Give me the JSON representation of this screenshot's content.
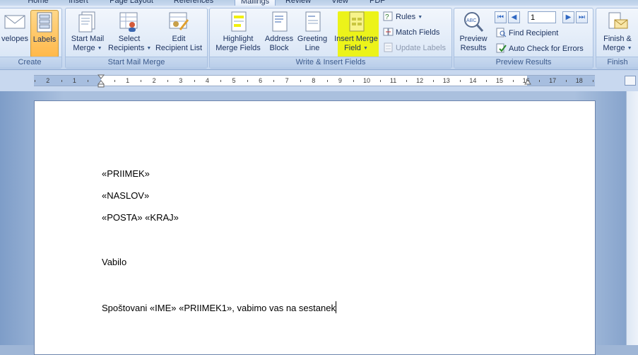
{
  "tabs": [
    {
      "label": "Home",
      "active": false
    },
    {
      "label": "Insert",
      "active": false
    },
    {
      "label": "Page Layout",
      "active": false
    },
    {
      "label": "References",
      "active": false
    },
    {
      "label": "Mailings",
      "active": true
    },
    {
      "label": "Review",
      "active": false
    },
    {
      "label": "View",
      "active": false
    },
    {
      "label": "PDF",
      "active": false
    }
  ],
  "ribbon": {
    "create": {
      "label": "Create",
      "envelopes": "velopes",
      "labels": "Labels"
    },
    "start_mail_merge": {
      "label": "Start Mail Merge",
      "start_l1": "Start Mail",
      "start_l2": "Merge",
      "select_l1": "Select",
      "select_l2": "Recipients",
      "edit_l1": "Edit",
      "edit_l2": "Recipient List"
    },
    "write_insert": {
      "label": "Write & Insert Fields",
      "highlight_l1": "Highlight",
      "highlight_l2": "Merge Fields",
      "address_l1": "Address",
      "address_l2": "Block",
      "greeting_l1": "Greeting",
      "greeting_l2": "Line",
      "insert_l1": "Insert Merge",
      "insert_l2": "Field",
      "rules": "Rules",
      "match_fields": "Match Fields",
      "update_labels": "Update Labels"
    },
    "preview": {
      "label": "Preview Results",
      "preview_l1": "Preview",
      "preview_l2": "Results",
      "record_value": "1",
      "find_recipient": "Find Recipient",
      "auto_check": "Auto Check for Errors"
    },
    "finish": {
      "label": "Finish",
      "finish_l1": "Finish &",
      "finish_l2": "Merge"
    }
  },
  "ruler": {
    "numbers": [
      "2",
      "1",
      "1",
      "2",
      "3",
      "4",
      "5",
      "6",
      "7",
      "8",
      "9",
      "10",
      "11",
      "12",
      "13",
      "14",
      "15",
      "16",
      "17",
      "18"
    ]
  },
  "document": {
    "paragraphs": [
      "«PRIIMEK»",
      "«NASLOV»",
      "«POSTA» «KRAJ»",
      "Vabilo",
      "Spoštovani «IME» «PRIIMEK1», vabimo vas na sestanek"
    ]
  },
  "colors": {
    "ribbon_bg": "#d3e1f4",
    "pressed_button": "#ffb84a",
    "highlight_yellow": "#ecf31a",
    "group_label_text": "#3b5a8c"
  },
  "icons": [
    "envelope-icon",
    "labels-icon",
    "start-mail-merge-icon",
    "select-recipients-icon",
    "edit-recipient-list-icon",
    "highlight-merge-fields-icon",
    "address-block-icon",
    "greeting-line-icon",
    "insert-merge-field-icon",
    "rules-icon",
    "match-fields-icon",
    "update-labels-icon",
    "preview-results-icon",
    "first-record-icon",
    "previous-record-icon",
    "next-record-icon",
    "last-record-icon",
    "find-recipient-icon",
    "auto-check-icon",
    "finish-merge-icon"
  ]
}
